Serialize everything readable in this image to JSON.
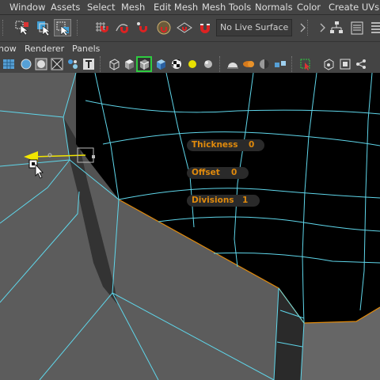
{
  "menubar": {
    "items": [
      "Window",
      "Assets",
      "Select",
      "Mesh",
      "Edit Mesh",
      "Mesh Tools",
      "Normals",
      "Color",
      "Create UVs"
    ]
  },
  "shelf": {
    "live_surface": "No Live Surface"
  },
  "panel_menu": {
    "items": [
      "how",
      "Renderer",
      "Panels"
    ]
  },
  "hud": {
    "thickness": {
      "label": "Thickness",
      "value": "0"
    },
    "offset": {
      "label": "Offset",
      "value": "0"
    },
    "divisions": {
      "label": "Divisions",
      "value": "1"
    }
  },
  "colors": {
    "accent_orange": "#e08a0c",
    "wire_cyan": "#5fd6ea",
    "manipulator_yellow": "#f2e600",
    "viewport_background": "#000000",
    "mesh_gray": "#5f5f5f"
  }
}
